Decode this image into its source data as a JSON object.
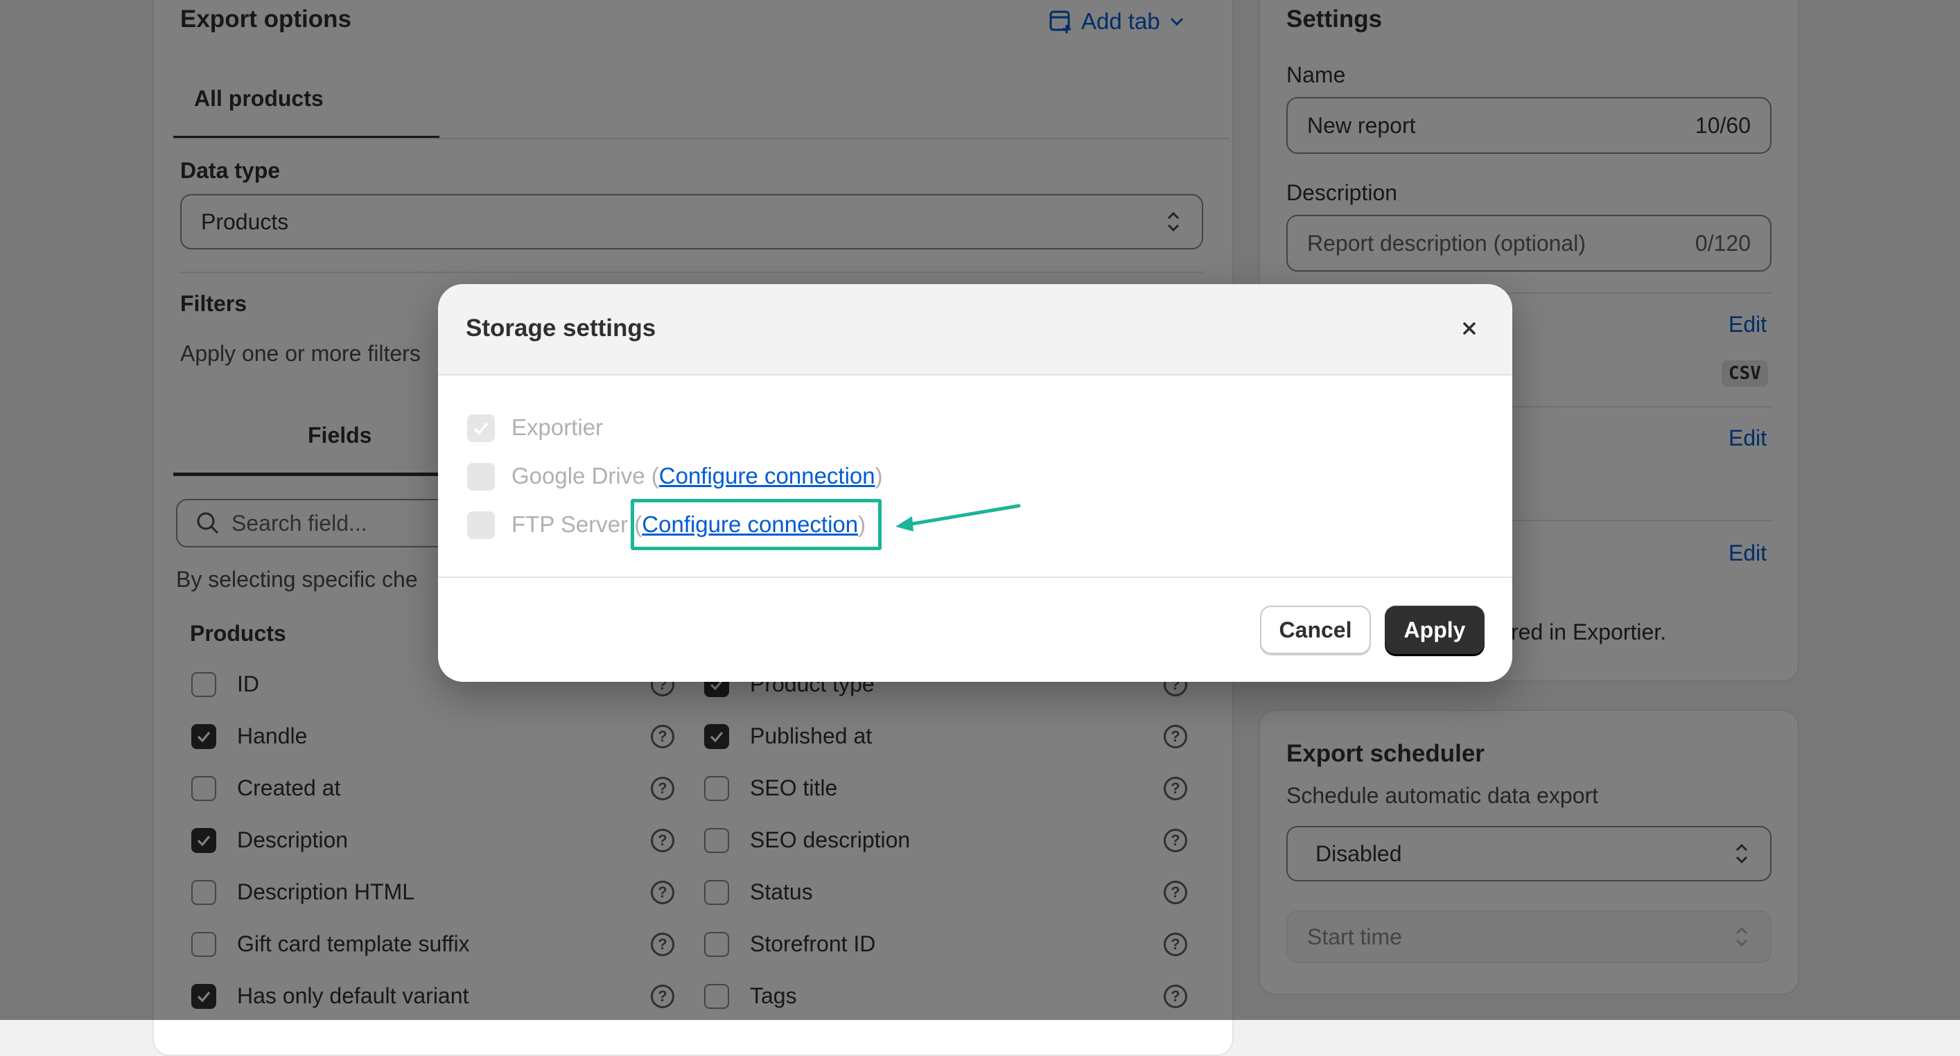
{
  "export_options": {
    "title": "Export options",
    "add_tab_label": "Add tab",
    "tabs": [
      {
        "label": "All products"
      }
    ],
    "data_type_label": "Data type",
    "data_type_value": "Products",
    "filters_title": "Filters",
    "filters_hint": "Apply one or more filters",
    "fields_tab_label": "Fields",
    "search_placeholder": "Search field...",
    "selection_hint": "By selecting specific che",
    "products_group_title": "Products",
    "fields_left": [
      {
        "label": "ID",
        "checked": false
      },
      {
        "label": "Handle",
        "checked": true
      },
      {
        "label": "Created at",
        "checked": false
      },
      {
        "label": "Description",
        "checked": true
      },
      {
        "label": "Description HTML",
        "checked": false
      },
      {
        "label": "Gift card template suffix",
        "checked": false
      },
      {
        "label": "Has only default variant",
        "checked": true
      }
    ],
    "fields_right": [
      {
        "label": "Product type",
        "checked": true
      },
      {
        "label": "Published at",
        "checked": true
      },
      {
        "label": "SEO title",
        "checked": false
      },
      {
        "label": "SEO description",
        "checked": false
      },
      {
        "label": "Status",
        "checked": false
      },
      {
        "label": "Storefront ID",
        "checked": false
      },
      {
        "label": "Tags",
        "checked": false
      }
    ]
  },
  "settings": {
    "title": "Settings",
    "name_label": "Name",
    "name_value": "New report",
    "name_counter": "10/60",
    "description_label": "Description",
    "description_placeholder": "Report description (optional)",
    "description_counter": "0/120",
    "edit_label": "Edit",
    "format_badge": "CSV",
    "storage_note_fragment": "red in Exportier."
  },
  "scheduler": {
    "title": "Export scheduler",
    "subtitle": "Schedule automatic data export",
    "frequency_value": "Disabled",
    "start_time_placeholder": "Start time"
  },
  "modal": {
    "title": "Storage settings",
    "options": [
      {
        "label": "Exportier",
        "checked": true,
        "link": ""
      },
      {
        "label": "Google Drive",
        "checked": false,
        "link": "Configure connection"
      },
      {
        "label": "FTP Server",
        "checked": false,
        "link": "Configure connection"
      }
    ],
    "cancel_label": "Cancel",
    "apply_label": "Apply"
  },
  "colors": {
    "accent": "#005bd3",
    "highlight": "#1bb59a",
    "primary_button": "#303030"
  }
}
